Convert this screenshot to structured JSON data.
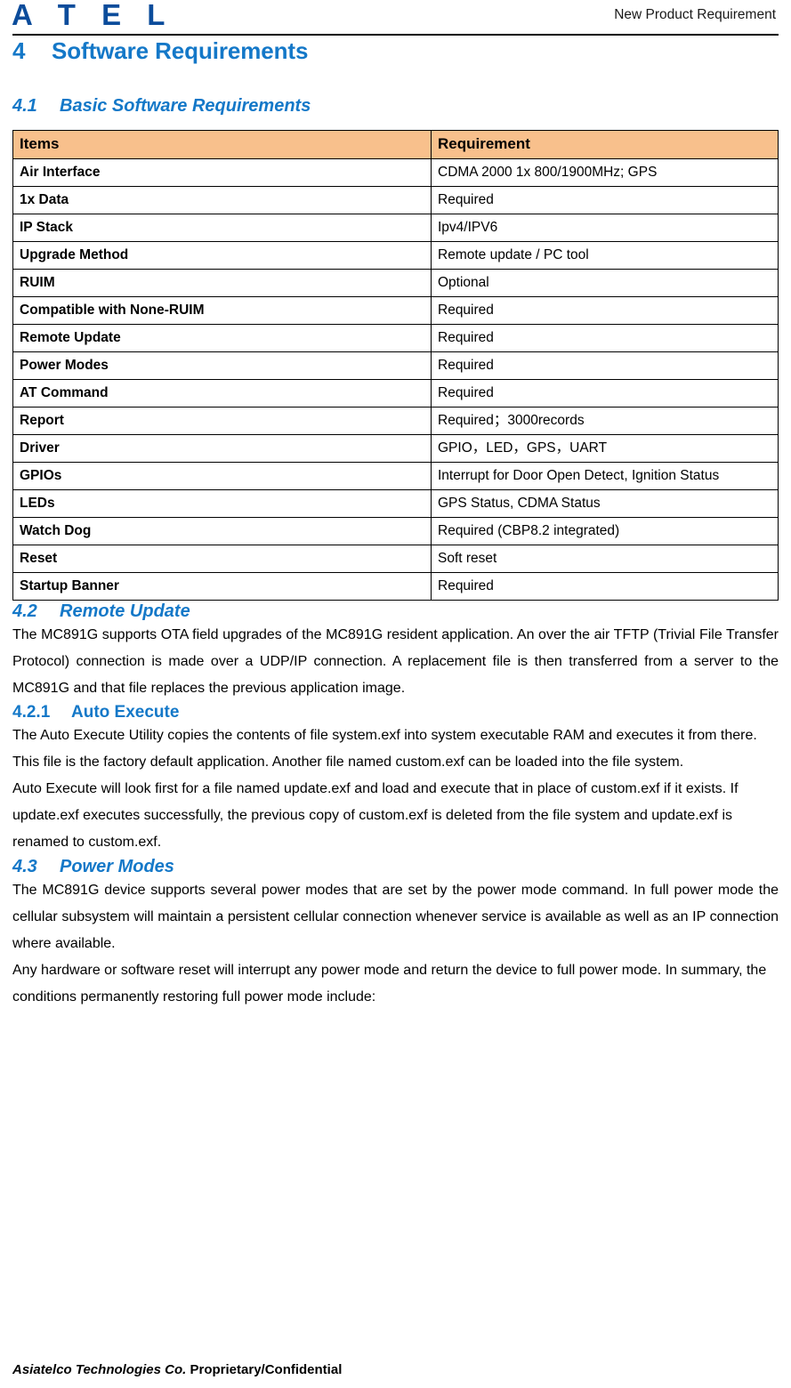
{
  "header": {
    "logo_text": "A T E L",
    "document_title": "New Product Requirement"
  },
  "section": {
    "number": "4",
    "title": "Software Requirements"
  },
  "sub_4_1": {
    "number": "4.1",
    "title": "Basic Software Requirements"
  },
  "table": {
    "columns": [
      "Items",
      "Requirement"
    ],
    "rows": [
      {
        "item": "Air Interface",
        "requirement": "CDMA 2000 1x 800/1900MHz; GPS"
      },
      {
        "item": "1x Data",
        "requirement": "Required"
      },
      {
        "item": "IP Stack",
        "requirement": "Ipv4/IPV6"
      },
      {
        "item": "Upgrade Method",
        "requirement": "Remote update / PC tool"
      },
      {
        "item": "RUIM",
        "requirement": "Optional"
      },
      {
        "item": "Compatible with None-RUIM",
        "requirement": "Required"
      },
      {
        "item": "Remote Update",
        "requirement": "Required"
      },
      {
        "item": "Power Modes",
        "requirement": "Required"
      },
      {
        "item": "AT Command",
        "requirement": "Required"
      },
      {
        "item": "Report",
        "requirement": "Required；3000records"
      },
      {
        "item": "Driver",
        "requirement": "GPIO，LED，GPS，UART"
      },
      {
        "item": "GPIOs",
        "requirement": "Interrupt for Door Open Detect, Ignition Status"
      },
      {
        "item": "LEDs",
        "requirement": "GPS Status, CDMA Status"
      },
      {
        "item": "Watch Dog",
        "requirement": "Required (CBP8.2 integrated)"
      },
      {
        "item": "Reset",
        "requirement": "Soft reset"
      },
      {
        "item": "Startup Banner",
        "requirement": "Required"
      }
    ]
  },
  "sub_4_2": {
    "number": "4.2",
    "title": "Remote Update",
    "paragraph": "The MC891G supports OTA field upgrades of the MC891G resident application. An over the air TFTP (Trivial File Transfer Protocol) connection is made over a UDP/IP connection. A replacement file is then transferred from a server to the MC891G and that file replaces the previous application image."
  },
  "sub_4_2_1": {
    "number": "4.2.1",
    "title": "Auto Execute",
    "paragraph_1": "The Auto Execute Utility copies the contents of file system.exf into system executable RAM and executes it from there. This file is the factory default application. Another file named custom.exf can be loaded into the file system.",
    "paragraph_2": "Auto Execute will look first for a file named update.exf and load and execute that in place of custom.exf if it exists. If update.exf executes successfully, the previous copy of custom.exf is deleted from the file system and update.exf is renamed to custom.exf."
  },
  "sub_4_3": {
    "number": "4.3",
    "title": "Power Modes",
    "paragraph_1": "The MC891G device supports several power modes that are set by the power mode command. In full power mode the cellular subsystem will maintain a persistent cellular connection whenever service is available as well as an IP connection where available.",
    "paragraph_2": "Any hardware or software reset will interrupt any power mode and return the device to full power mode. In summary, the conditions permanently restoring full power mode include:"
  },
  "footer": {
    "company": "Asiatelco Technologies Co.",
    "confidentiality": "Proprietary/Confidential"
  },
  "colors": {
    "heading_blue": "#1478C8",
    "logo_blue": "#0B4C9B",
    "table_header_peach": "#F8C08C",
    "text_black": "#000000"
  }
}
